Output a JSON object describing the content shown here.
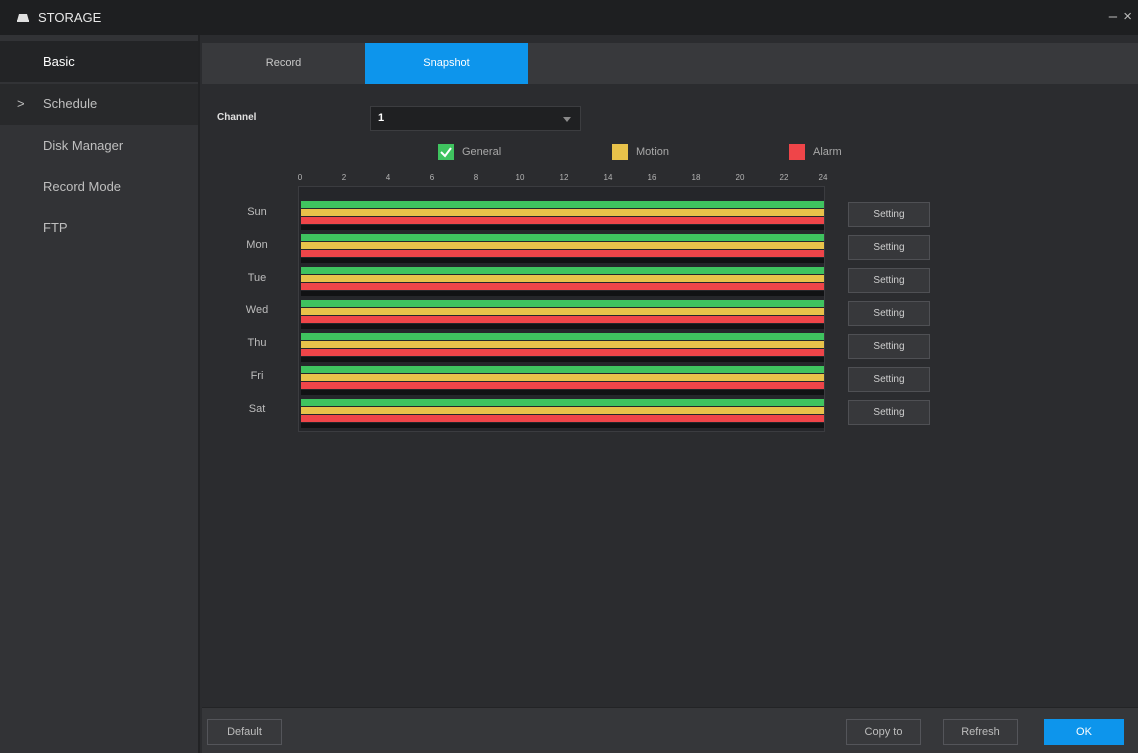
{
  "window": {
    "title": "STORAGE",
    "minimize_label": "–",
    "close_label": "×"
  },
  "sidebar": {
    "items": [
      {
        "label": "Basic",
        "chevron": ""
      },
      {
        "label": "Schedule",
        "chevron": ">"
      },
      {
        "label": "Disk Manager",
        "chevron": ""
      },
      {
        "label": "Record Mode",
        "chevron": ""
      },
      {
        "label": "FTP",
        "chevron": ""
      }
    ]
  },
  "tabs": [
    {
      "label": "Record",
      "active": false
    },
    {
      "label": "Snapshot",
      "active": true
    }
  ],
  "channel": {
    "label": "Channel",
    "value": "1"
  },
  "legend": [
    {
      "label": "General",
      "color": "#3fc35f",
      "checked": true
    },
    {
      "label": "Motion",
      "color": "#e8c24a",
      "checked": false
    },
    {
      "label": "Alarm",
      "color": "#ef4549",
      "checked": false
    }
  ],
  "timeline": {
    "ticks": [
      "0",
      "2",
      "4",
      "6",
      "8",
      "10",
      "12",
      "14",
      "16",
      "18",
      "20",
      "22",
      "24"
    ]
  },
  "schedule": [
    {
      "day": "Sun",
      "setting_label": "Setting"
    },
    {
      "day": "Mon",
      "setting_label": "Setting"
    },
    {
      "day": "Tue",
      "setting_label": "Setting"
    },
    {
      "day": "Wed",
      "setting_label": "Setting"
    },
    {
      "day": "Thu",
      "setting_label": "Setting"
    },
    {
      "day": "Fri",
      "setting_label": "Setting"
    },
    {
      "day": "Sat",
      "setting_label": "Setting"
    }
  ],
  "footer": {
    "default_label": "Default",
    "copy_label": "Copy to",
    "refresh_label": "Refresh",
    "ok_label": "OK"
  },
  "colors": {
    "accent": "#0d95ec",
    "general": "#3fc35f",
    "motion": "#e8c24a",
    "alarm": "#ef4549"
  }
}
